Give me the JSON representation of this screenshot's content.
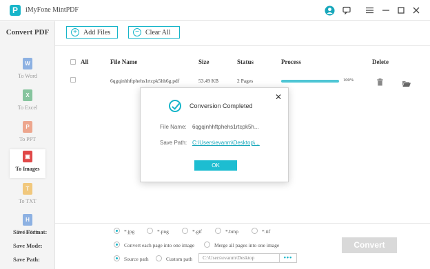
{
  "app": {
    "logo_letter": "P",
    "title": "iMyFone MintPDF"
  },
  "sidebar": {
    "title": "Convert PDF",
    "items": [
      {
        "label": "To Word",
        "icon": "word-icon",
        "glyph": "W",
        "color": "#3a7bd5"
      },
      {
        "label": "To Excel",
        "icon": "excel-icon",
        "glyph": "X",
        "color": "#2e9e58"
      },
      {
        "label": "To PPT",
        "icon": "ppt-icon",
        "glyph": "P",
        "color": "#e8673b"
      },
      {
        "label": "To Images",
        "icon": "images-icon",
        "glyph": "▣",
        "color": "#e04848"
      },
      {
        "label": "To TXT",
        "icon": "txt-icon",
        "glyph": "T",
        "color": "#f0a51d"
      },
      {
        "label": "To HTML",
        "icon": "html-icon",
        "glyph": "H",
        "color": "#3a7bd5"
      }
    ],
    "active": "To Images"
  },
  "toolbar": {
    "add_files": "Add Files",
    "clear_all": "Clear All"
  },
  "table": {
    "headers": {
      "all": "All",
      "file_name": "File Name",
      "size": "Size",
      "status": "Status",
      "process": "Process",
      "delete": "Delete"
    },
    "rows": [
      {
        "file_name": "6qgqinhhftphehs1rtcpk5hh6g.pdf",
        "size": "53.49 KB",
        "status": "2 Pages",
        "progress_label": "100%",
        "progress": 1.0
      }
    ]
  },
  "options": {
    "save_format_label": "Save Format:",
    "formats": [
      "*.jpg",
      "*.png",
      "*.gif",
      "*.bmp",
      "*.tif"
    ],
    "selected_format": "*.jpg",
    "save_mode_label": "Save Mode:",
    "modes": [
      "Convert each page into one image",
      "Merge all pages into one image"
    ],
    "selected_mode": "Convert each page into one image",
    "save_path_label": "Save Path:",
    "path_options": [
      "Source path",
      "Custom path"
    ],
    "selected_path": "Source path",
    "custom_path_value": "C:\\Users\\evanm\\Desktop",
    "browse_label": "•••"
  },
  "convert_button": "Convert",
  "dialog": {
    "title": "Conversion Completed",
    "close": "✕",
    "file_name_label": "File Name:",
    "file_name_value": "6qgqinhhftphehs1rtcpk5h...",
    "save_path_label": "Save Path:",
    "save_path_value": "C:\\Users\\evanm\\Desktop\\...",
    "ok_label": "OK"
  },
  "colors": {
    "accent": "#17b5c9",
    "progress_fill": "#4fc6d5",
    "convert_disabled": "#d9d9d9"
  }
}
